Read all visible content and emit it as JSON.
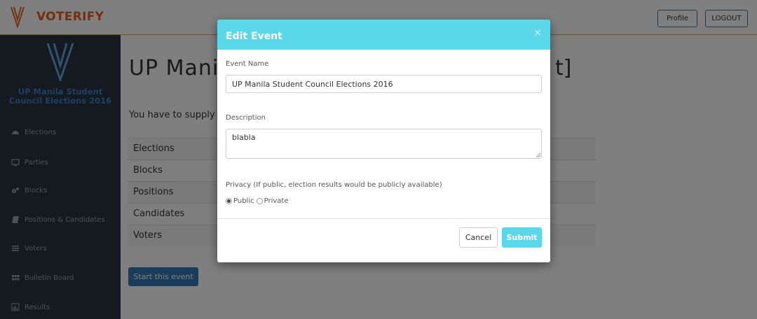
{
  "app": {
    "name": "VOTERIFY",
    "brand_color": "#e8611a"
  },
  "nav": {
    "profile_label": "Profile",
    "logout_label": "LOGOUT"
  },
  "sidebar": {
    "event_title": "UP Manila Student Council Elections 2016",
    "items": [
      {
        "label": "Elections",
        "icon": "dashboard-icon"
      },
      {
        "label": "Parties",
        "icon": "monitor-icon"
      },
      {
        "label": "Blocks",
        "icon": "cogs-icon"
      },
      {
        "label": "Positions & Candidates",
        "icon": "book-icon"
      },
      {
        "label": "Voters",
        "icon": "list-icon"
      },
      {
        "label": "Bulletin Board",
        "icon": "grid-icon"
      },
      {
        "label": "Results",
        "icon": "bar-chart-icon"
      }
    ]
  },
  "main": {
    "title": "UP Manila",
    "title_end": "t]",
    "subtitle": "You have to supply",
    "table_rows": [
      "Elections",
      "Blocks",
      "Positions",
      "Candidates",
      "Voters"
    ],
    "start_button": "Start this event"
  },
  "modal": {
    "title": "Edit Event",
    "close_glyph": "×",
    "event_name_label": "Event Name",
    "event_name_value": "UP Manila Student Council Elections 2016",
    "description_label": "Description",
    "description_value": "blabla",
    "privacy_label": "Privacy (If public, election results would be publicly available)",
    "privacy_options": [
      "Public",
      "Private"
    ],
    "privacy_selected": "Public",
    "cancel_label": "Cancel",
    "submit_label": "Submit",
    "header_color": "#5bd7ea"
  }
}
